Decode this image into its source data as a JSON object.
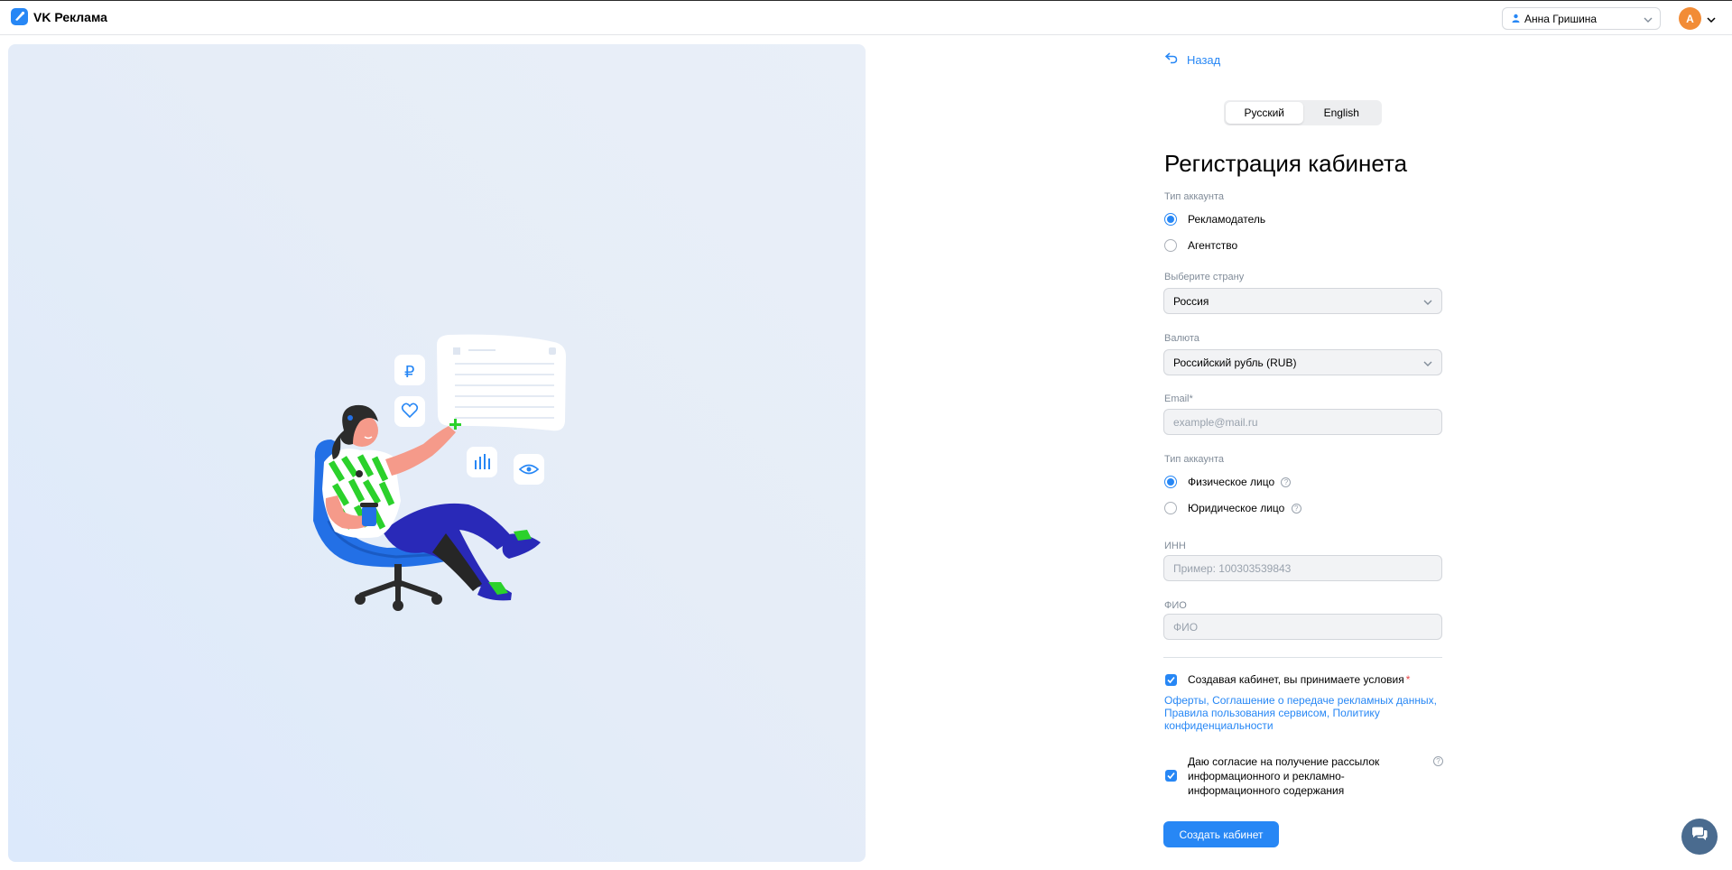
{
  "header": {
    "logo_text": "VK Реклама",
    "user_name": "Анна Гришина",
    "avatar_letter": "А"
  },
  "form": {
    "back_label": "Назад",
    "languages": [
      {
        "label": "Русский",
        "active": true
      },
      {
        "label": "English",
        "active": false
      }
    ],
    "title": "Регистрация кабинета",
    "account_type": {
      "label": "Тип аккаунта",
      "options": [
        {
          "label": "Рекламодатель",
          "selected": true
        },
        {
          "label": "Агентство",
          "selected": false
        }
      ]
    },
    "country": {
      "label": "Выберите страну",
      "value": "Россия"
    },
    "currency": {
      "label": "Валюта",
      "value": "Российский рубль (RUB)"
    },
    "email": {
      "label": "Email*",
      "placeholder": "example@mail.ru",
      "value": ""
    },
    "person_type": {
      "label": "Тип аккаунта",
      "options": [
        {
          "label": "Физическое лицо",
          "selected": true
        },
        {
          "label": "Юридическое лицо",
          "selected": false
        }
      ]
    },
    "inn": {
      "label": "ИНН",
      "placeholder": "Пример: 100303539843",
      "value": ""
    },
    "fio": {
      "label": "ФИО",
      "placeholder": "ФИО",
      "value": ""
    },
    "terms": {
      "checked": true,
      "text": "Создавая кабинет, вы принимаете условия",
      "required_mark": "*",
      "links_text": "Оферты, Соглашение о передаче рекламных данных, Правила пользования сервисом, Политику конфиденциальности"
    },
    "newsletter": {
      "checked": true,
      "line1": "Даю согласие на получение рассылок",
      "line2": "информационного и рекламно-",
      "line3": "информационного содержания"
    },
    "submit_label": "Создать кабинет"
  },
  "colors": {
    "accent": "#2787f5",
    "avatar": "#f28c36",
    "chat_fab": "#4a6b8f"
  }
}
